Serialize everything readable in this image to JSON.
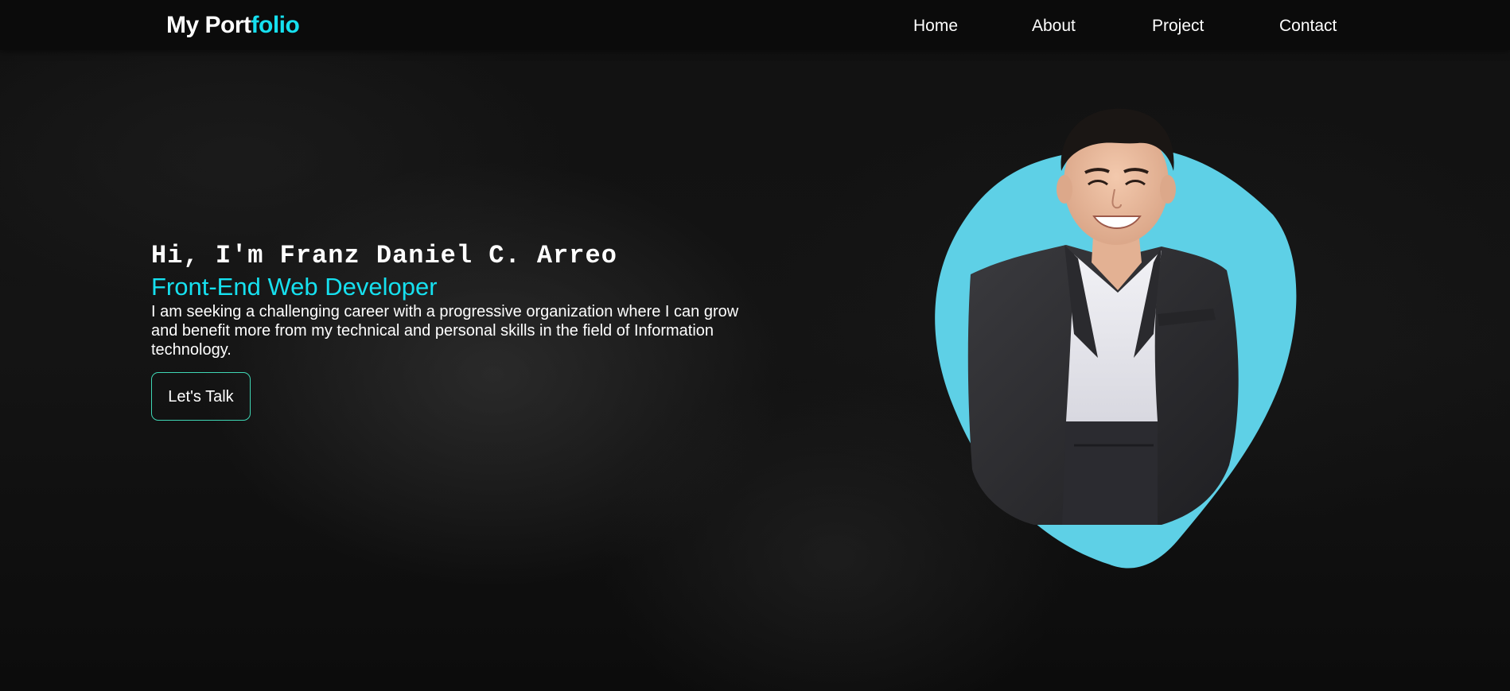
{
  "header": {
    "logo_part1": "My Port",
    "logo_part2": "folio",
    "nav": [
      "Home",
      "About",
      "Project",
      "Contact"
    ]
  },
  "hero": {
    "greeting": "Hi, I'm Franz Daniel C. Arreo",
    "role": "Front-End Web Developer",
    "description": "I am seeking a challenging career with a progressive organization where I can grow and benefit more from my technical and personal skills in the field of Information technology.",
    "cta_label": "Let's Talk"
  },
  "colors": {
    "accent": "#16e0ef",
    "blob": "#5ed0e6",
    "button_border": "#3fd6b4",
    "background": "#111111"
  },
  "icons": {
    "portrait": "profile-photo"
  }
}
